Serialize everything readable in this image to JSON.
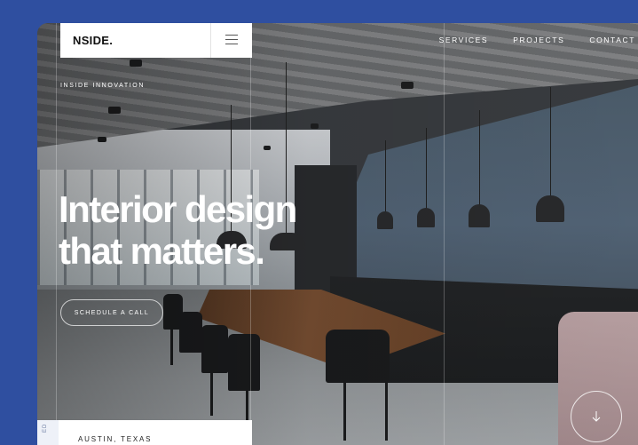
{
  "header": {
    "logo": "NSIDE.",
    "nav": [
      {
        "label": "SERVICES"
      },
      {
        "label": "PROJECTS"
      },
      {
        "label": "CONTACT"
      }
    ],
    "menu_icon": "hamburger-menu-icon"
  },
  "hero": {
    "eyebrow": "INSIDE INNOVATION",
    "title_line1": "Interior design",
    "title_line2": "that matters.",
    "cta_label": "SCHEDULE A CALL"
  },
  "location": {
    "side_label": "ED",
    "text": "AUSTIN, TEXAS"
  },
  "scroll": {
    "icon": "arrow-down-icon"
  },
  "colors": {
    "page_background": "#2f4fa0",
    "text_light": "#ffffff",
    "card_background": "#ffffff"
  }
}
